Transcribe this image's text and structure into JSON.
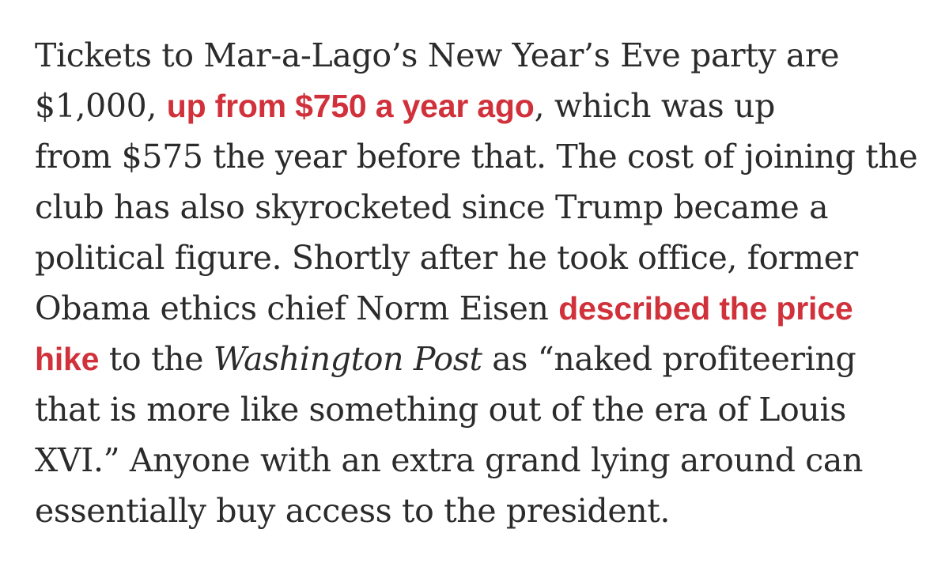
{
  "article": {
    "lines": [
      {
        "text": "Tickets to Mar-a-Lago’s New Year’s Eve party are"
      },
      {
        "before": "$1,000, ",
        "link": "up from $750 a year ago",
        "after": ", which was up"
      },
      {
        "text": "from $575 the year before that. The cost of joining the"
      },
      {
        "text": "club has also skyrocketed since Trump became a"
      },
      {
        "text": "political figure. Shortly after he took office, former"
      },
      {
        "before": "Obama ethics chief Norm Eisen ",
        "link": "described the price"
      },
      {
        "link": "hike",
        "middle": " to the ",
        "publication": "Washington Post",
        "after": " as “naked profiteering"
      },
      {
        "text": "that is more like something out of the era of Louis"
      },
      {
        "text": "XVI.” Anyone with an extra grand lying around can"
      },
      {
        "text": "essentially buy access to the president."
      }
    ]
  },
  "colors": {
    "body_text": "#2b2b2b",
    "link": "#d0313a",
    "background": "#ffffff"
  }
}
